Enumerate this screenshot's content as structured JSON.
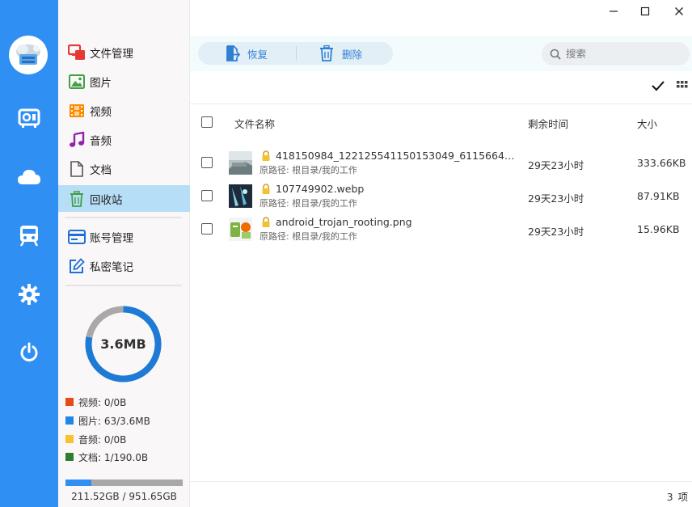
{
  "window": {
    "minimize_glyph": "—",
    "maximize_glyph": "☐",
    "close_glyph": "✕"
  },
  "rail": {
    "items": [
      {
        "icon": "disk-icon"
      },
      {
        "icon": "cloud-icon"
      },
      {
        "icon": "train-icon"
      },
      {
        "icon": "gear-icon"
      },
      {
        "icon": "power-icon"
      }
    ]
  },
  "sidebar": {
    "items": [
      {
        "label": "文件管理",
        "icon": "file-manager-icon",
        "color": "#e53935"
      },
      {
        "label": "图片",
        "icon": "image-icon",
        "color": "#43a047"
      },
      {
        "label": "视频",
        "icon": "video-icon",
        "color": "#fb8c00"
      },
      {
        "label": "音频",
        "icon": "music-icon",
        "color": "#8e24aa"
      },
      {
        "label": "文档",
        "icon": "document-icon",
        "color": "#555555"
      },
      {
        "label": "回收站",
        "icon": "trash-icon",
        "color": "#43a047",
        "active": true
      }
    ],
    "extra_items": [
      {
        "label": "账号管理",
        "icon": "account-card-icon",
        "color": "#1e6fd9"
      },
      {
        "label": "私密笔记",
        "icon": "note-edit-icon",
        "color": "#1e6fd9"
      }
    ],
    "storage": {
      "used_label": "3.6MB",
      "legend": [
        {
          "label": "视频: 0/0B",
          "color": "#e64a19"
        },
        {
          "label": "图片: 63/3.6MB",
          "color": "#1e88e5"
        },
        {
          "label": "音频: 0/0B",
          "color": "#fbc02d"
        },
        {
          "label": "文档: 1/190.0B",
          "color": "#2e7d32"
        }
      ],
      "disk_text": "211.52GB / 951.65GB",
      "disk_fraction": 0.222,
      "donut_color": "#1e7ad7",
      "donut_fraction": 0.78
    }
  },
  "toolbar": {
    "restore_label": "恢复",
    "delete_label": "删除",
    "search_placeholder": "搜索"
  },
  "table": {
    "headers": {
      "name": "文件名称",
      "remaining": "剩余时间",
      "size": "大小"
    },
    "rows": [
      {
        "name": "418150984_122125541150153049_611566416462...",
        "path": "原路径: 根目录/我的工作",
        "remaining": "29天23小时",
        "size": "333.66KB",
        "thumb": "photo-thumb"
      },
      {
        "name": "107749902.webp",
        "path": "原路径: 根目录/我的工作",
        "remaining": "29天23小时",
        "size": "87.91KB",
        "thumb": "photo-thumb"
      },
      {
        "name": "android_trojan_rooting.png",
        "path": "原路径: 根目录/我的工作",
        "remaining": "29天23小时",
        "size": "15.96KB",
        "thumb": "android-thumb"
      }
    ]
  },
  "footer": {
    "count_label": "3 项"
  }
}
